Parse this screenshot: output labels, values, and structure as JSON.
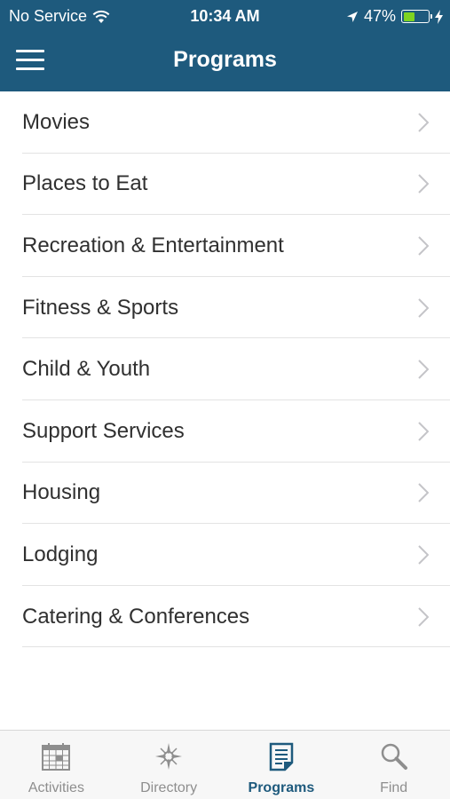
{
  "status_bar": {
    "carrier": "No Service",
    "time": "10:34 AM",
    "battery": "47%",
    "battery_level": 0.47,
    "icons": [
      "wifi-icon",
      "location-arrow-icon",
      "battery-icon",
      "charging-bolt-icon"
    ]
  },
  "nav": {
    "title": "Programs",
    "menu_icon": "hamburger-menu-icon"
  },
  "list": {
    "items": [
      {
        "label": "Movies"
      },
      {
        "label": "Places to Eat"
      },
      {
        "label": "Recreation & Entertainment"
      },
      {
        "label": "Fitness & Sports"
      },
      {
        "label": "Child & Youth"
      },
      {
        "label": "Support Services"
      },
      {
        "label": "Housing"
      },
      {
        "label": "Lodging"
      },
      {
        "label": "Catering & Conferences"
      }
    ],
    "chevron_icon": "chevron-right-icon"
  },
  "tabs": {
    "items": [
      {
        "label": "Activities",
        "icon": "calendar-icon",
        "active": false
      },
      {
        "label": "Directory",
        "icon": "compass-icon",
        "active": false
      },
      {
        "label": "Programs",
        "icon": "document-icon",
        "active": true
      },
      {
        "label": "Find",
        "icon": "magnifier-icon",
        "active": false
      }
    ]
  },
  "colors": {
    "header_bg": "#1e5a7d",
    "active_tab": "#1e5a7d",
    "inactive_tab": "#8e8e8e",
    "battery_fill": "#7ed321"
  }
}
